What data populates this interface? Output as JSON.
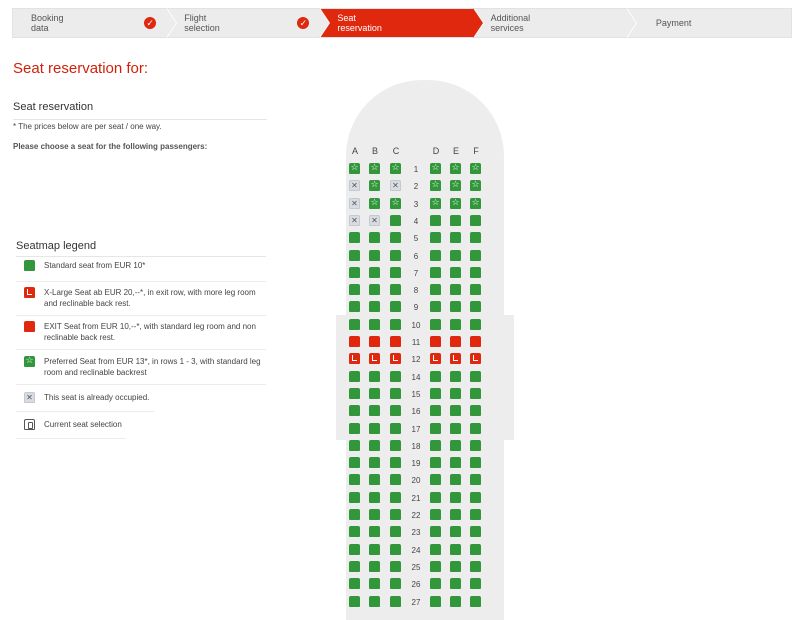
{
  "steps": [
    {
      "line1": "Booking",
      "line2": "data",
      "state": "done"
    },
    {
      "line1": "Flight",
      "line2": "selection",
      "state": "done"
    },
    {
      "line1": "Seat",
      "line2": "reservation",
      "state": "active"
    },
    {
      "line1": "Additional",
      "line2": "services",
      "state": "todo"
    },
    {
      "line1": "Payment",
      "line2": "",
      "state": "todo"
    }
  ],
  "page_title": "Seat reservation for:",
  "section_title": "Seat reservation",
  "price_note": "* The prices below are per seat / one way.",
  "choose_text": "Please choose a seat for the following passengers:",
  "legend": {
    "title": "Seatmap legend",
    "items": [
      {
        "type": "std",
        "text": "Standard seat from EUR 10*"
      },
      {
        "type": "xl",
        "text": "X-Large Seat ab EUR 20,--*, in exit row, with more leg room and reclinable back rest."
      },
      {
        "type": "exit",
        "text": "EXIT Seat from EUR 10,--*, with standard leg room and non reclinable back rest."
      },
      {
        "type": "pref",
        "text": "Preferred Seat from EUR 13*, in rows 1 - 3, with standard leg room and reclinable backrest"
      },
      {
        "type": "occ",
        "text": "This seat is already occupied."
      },
      {
        "type": "cur",
        "text": "Current seat selection"
      }
    ]
  },
  "seatmap": {
    "columns_left": [
      "A",
      "B",
      "C"
    ],
    "columns_right": [
      "D",
      "E",
      "F"
    ],
    "rows": [
      {
        "num": "1",
        "seats": [
          "pref",
          "pref",
          "pref",
          "pref",
          "pref",
          "pref"
        ]
      },
      {
        "num": "2",
        "seats": [
          "occ",
          "pref",
          "occ",
          "pref",
          "pref",
          "pref"
        ]
      },
      {
        "num": "3",
        "seats": [
          "occ",
          "pref",
          "pref",
          "pref",
          "pref",
          "pref"
        ]
      },
      {
        "num": "4",
        "seats": [
          "occ",
          "occ",
          "std",
          "std",
          "std",
          "std"
        ]
      },
      {
        "num": "5",
        "seats": [
          "std",
          "std",
          "std",
          "std",
          "std",
          "std"
        ]
      },
      {
        "num": "6",
        "seats": [
          "std",
          "std",
          "std",
          "std",
          "std",
          "std"
        ]
      },
      {
        "num": "7",
        "seats": [
          "std",
          "std",
          "std",
          "std",
          "std",
          "std"
        ]
      },
      {
        "num": "8",
        "seats": [
          "std",
          "std",
          "std",
          "std",
          "std",
          "std"
        ]
      },
      {
        "num": "9",
        "seats": [
          "std",
          "std",
          "std",
          "std",
          "std",
          "std"
        ]
      },
      {
        "num": "10",
        "seats": [
          "std",
          "std",
          "std",
          "std",
          "std",
          "std"
        ]
      },
      {
        "num": "11",
        "seats": [
          "exit",
          "exit",
          "exit",
          "exit",
          "exit",
          "exit"
        ]
      },
      {
        "num": "12",
        "seats": [
          "xl",
          "xl",
          "xl",
          "xl",
          "xl",
          "xl"
        ]
      },
      {
        "num": "14",
        "seats": [
          "std",
          "std",
          "std",
          "std",
          "std",
          "std"
        ]
      },
      {
        "num": "15",
        "seats": [
          "std",
          "std",
          "std",
          "std",
          "std",
          "std"
        ]
      },
      {
        "num": "16",
        "seats": [
          "std",
          "std",
          "std",
          "std",
          "std",
          "std"
        ]
      },
      {
        "num": "17",
        "seats": [
          "std",
          "std",
          "std",
          "std",
          "std",
          "std"
        ]
      },
      {
        "num": "18",
        "seats": [
          "std",
          "std",
          "std",
          "std",
          "std",
          "std"
        ]
      },
      {
        "num": "19",
        "seats": [
          "std",
          "std",
          "std",
          "std",
          "std",
          "std"
        ]
      },
      {
        "num": "20",
        "seats": [
          "std",
          "std",
          "std",
          "std",
          "std",
          "std"
        ]
      },
      {
        "num": "21",
        "seats": [
          "std",
          "std",
          "std",
          "std",
          "std",
          "std"
        ]
      },
      {
        "num": "22",
        "seats": [
          "std",
          "std",
          "std",
          "std",
          "std",
          "std"
        ]
      },
      {
        "num": "23",
        "seats": [
          "std",
          "std",
          "std",
          "std",
          "std",
          "std"
        ]
      },
      {
        "num": "24",
        "seats": [
          "std",
          "std",
          "std",
          "std",
          "std",
          "std"
        ]
      },
      {
        "num": "25",
        "seats": [
          "std",
          "std",
          "std",
          "std",
          "std",
          "std"
        ]
      },
      {
        "num": "26",
        "seats": [
          "std",
          "std",
          "std",
          "std",
          "std",
          "std"
        ]
      },
      {
        "num": "27",
        "seats": [
          "std",
          "std",
          "std",
          "std",
          "std",
          "std"
        ]
      }
    ]
  },
  "colors": {
    "accent": "#e0280f",
    "seat_green": "#32963a",
    "occupied": "#d8dce3"
  }
}
